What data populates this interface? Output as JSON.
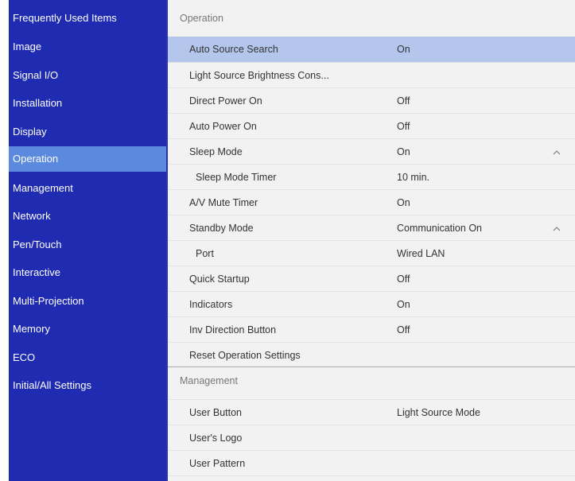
{
  "sidebar": {
    "items": [
      {
        "label": "Frequently Used Items",
        "active": false
      },
      {
        "label": "Image",
        "active": false
      },
      {
        "label": "Signal I/O",
        "active": false
      },
      {
        "label": "Installation",
        "active": false
      },
      {
        "label": "Display",
        "active": false
      },
      {
        "label": "Operation",
        "active": true
      },
      {
        "label": "Management",
        "active": false
      },
      {
        "label": "Network",
        "active": false
      },
      {
        "label": "Pen/Touch",
        "active": false
      },
      {
        "label": "Interactive",
        "active": false
      },
      {
        "label": "Multi-Projection",
        "active": false
      },
      {
        "label": "Memory",
        "active": false
      },
      {
        "label": "ECO",
        "active": false
      },
      {
        "label": "Initial/All Settings",
        "active": false
      }
    ]
  },
  "main": {
    "operation_header": "Operation",
    "operation_rows": [
      {
        "label": "Auto Source Search",
        "value": "On",
        "selected": true
      },
      {
        "label": "Light Source Brightness Cons...",
        "value": ""
      },
      {
        "label": "Direct Power On",
        "value": "Off"
      },
      {
        "label": "Auto Power On",
        "value": "Off"
      },
      {
        "label": "Sleep Mode",
        "value": "On",
        "chevron": "chevron-up-icon"
      },
      {
        "label": "Sleep Mode Timer",
        "value": "10 min.",
        "sub": true
      },
      {
        "label": "A/V Mute Timer",
        "value": "On"
      },
      {
        "label": "Standby Mode",
        "value": "Communication On",
        "chevron": "chevron-up-icon"
      },
      {
        "label": "Port",
        "value": "Wired LAN",
        "sub": true
      },
      {
        "label": "Quick Startup",
        "value": "Off"
      },
      {
        "label": "Indicators",
        "value": "On"
      },
      {
        "label": "Inv Direction Button",
        "value": "Off"
      },
      {
        "label": "Reset Operation Settings",
        "value": ""
      }
    ],
    "management_header": "Management",
    "management_rows": [
      {
        "label": "User Button",
        "value": "Light Source Mode"
      },
      {
        "label": "User's Logo",
        "value": ""
      },
      {
        "label": "User Pattern",
        "value": ""
      }
    ]
  },
  "colors": {
    "sidebar_bg": "#1f2bb0",
    "sidebar_active": "#5b89dd",
    "row_selected": "#b5c6ec",
    "panel_bg": "#f2f2f2"
  }
}
